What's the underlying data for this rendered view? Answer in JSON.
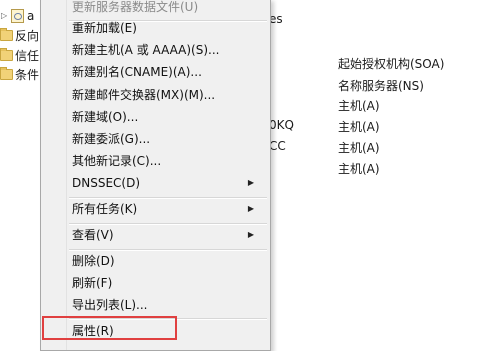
{
  "tree": {
    "items": [
      {
        "label": "a",
        "expander": "▷"
      },
      {
        "label": "反向"
      },
      {
        "label": "信任"
      },
      {
        "label": "条件"
      }
    ]
  },
  "background": {
    "header_fragment": "es",
    "name_fragments": [
      "0KQ",
      "CC"
    ],
    "record_types": [
      "起始授权机构(SOA)",
      "名称服务器(NS)",
      "主机(A)",
      "主机(A)",
      "主机(A)",
      "主机(A)"
    ]
  },
  "menu": {
    "items": [
      {
        "label": "更新服务器数据文件(U)",
        "disabled": true
      },
      {
        "label": "重新加载(E)"
      },
      {
        "label": "新建主机(A 或 AAAA)(S)..."
      },
      {
        "label": "新建别名(CNAME)(A)..."
      },
      {
        "label": "新建邮件交换器(MX)(M)..."
      },
      {
        "label": "新建域(O)..."
      },
      {
        "label": "新建委派(G)..."
      },
      {
        "label": "其他新记录(C)..."
      },
      {
        "label": "DNSSEC(D)",
        "submenu_arrow": "▶"
      },
      {
        "label": "所有任务(K)",
        "submenu_arrow": "▶"
      },
      {
        "label": "查看(V)",
        "submenu_arrow": "▶"
      },
      {
        "label": "删除(D)"
      },
      {
        "label": "刷新(F)"
      },
      {
        "label": "导出列表(L)..."
      },
      {
        "label": "属性(R)"
      }
    ]
  },
  "colors": {
    "menu_background": "#f0f0f0",
    "highlight_border": "#e04040"
  }
}
